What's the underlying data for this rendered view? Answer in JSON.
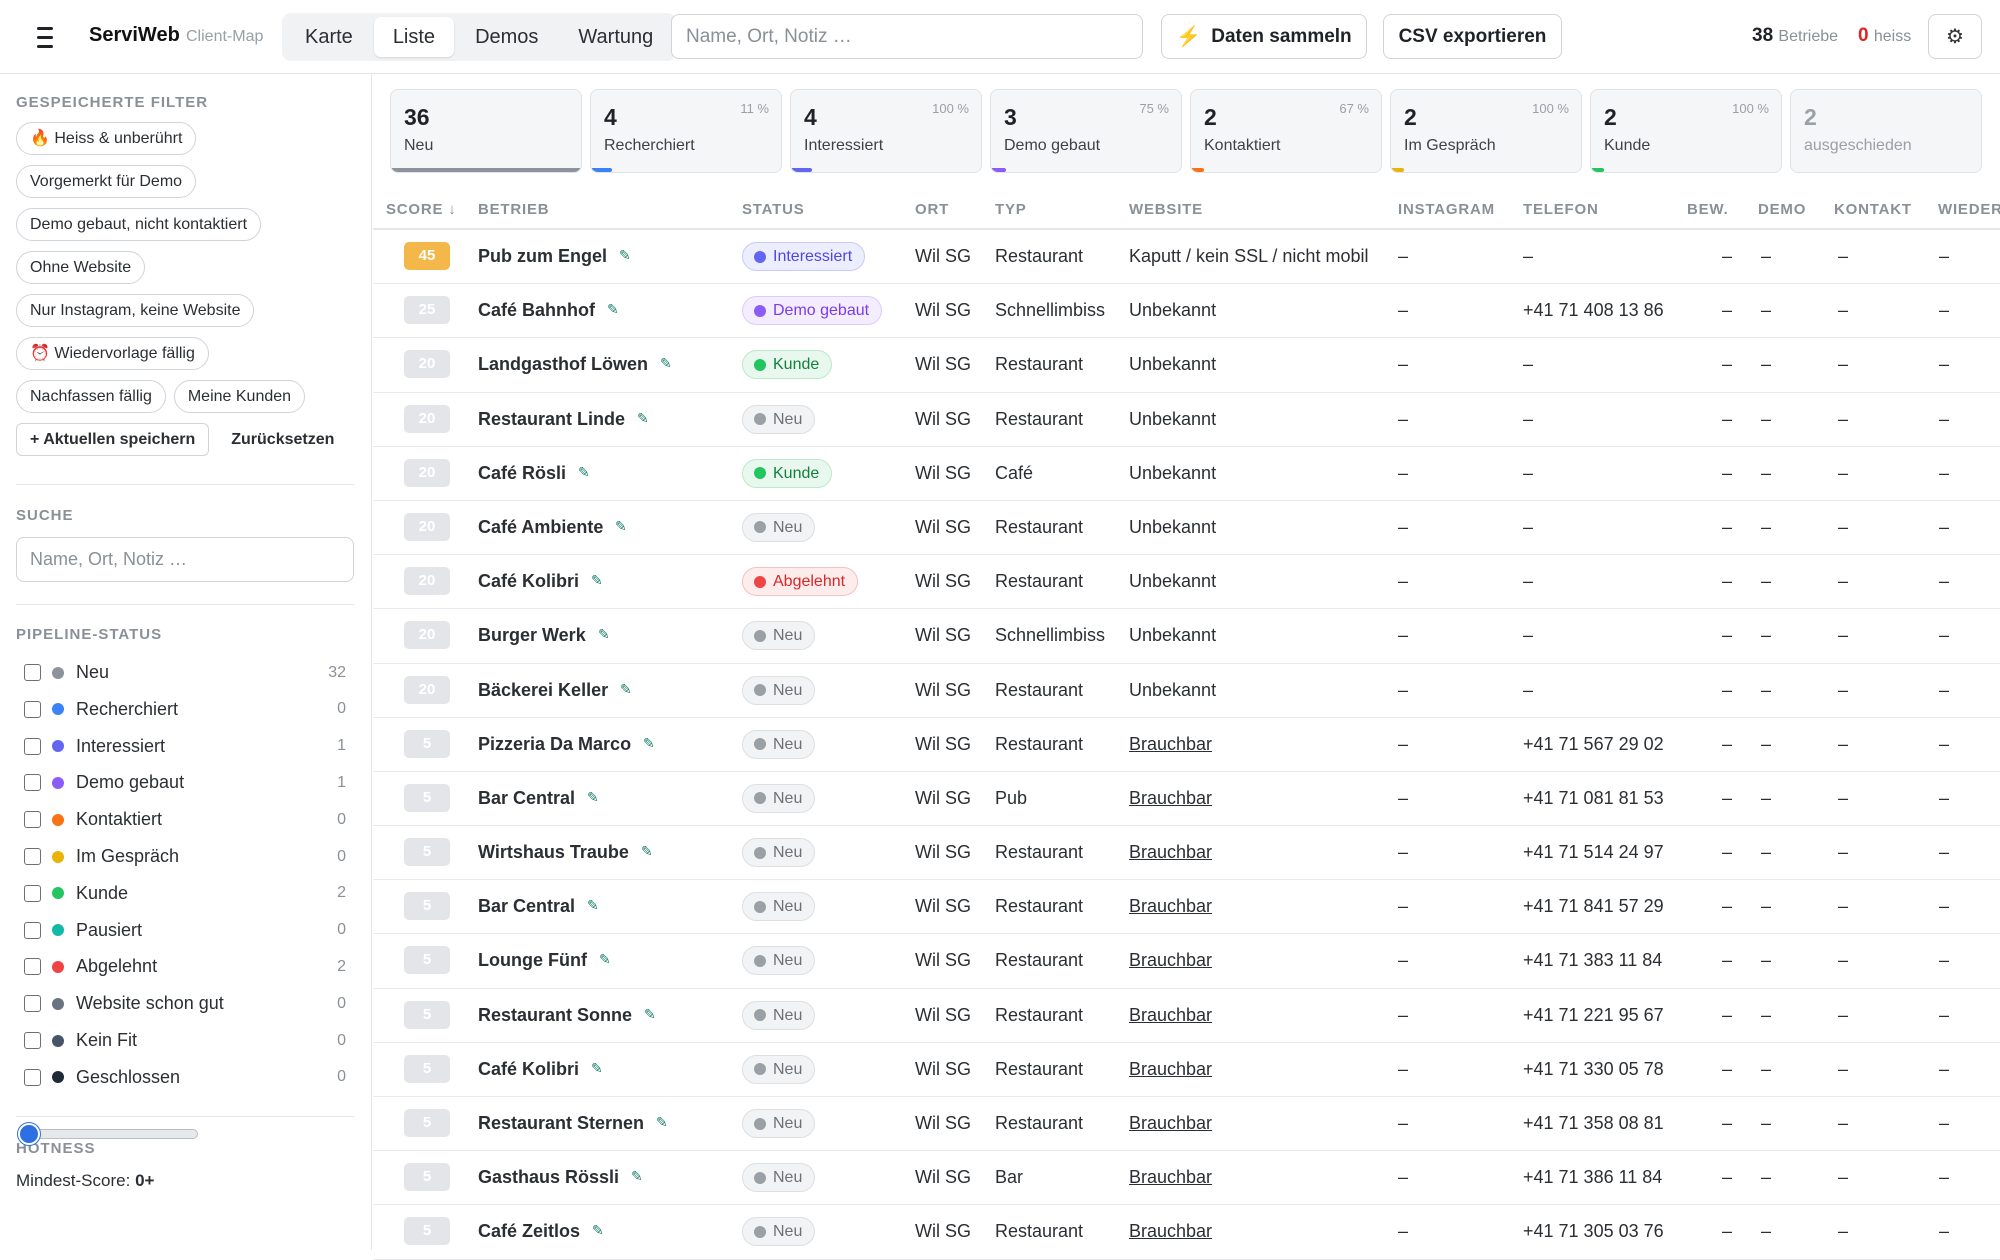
{
  "app": {
    "title": "ServiWeb",
    "subtitle": "Client-Map"
  },
  "nav_tabs": [
    {
      "label": "Karte",
      "active": false
    },
    {
      "label": "Liste",
      "active": true
    },
    {
      "label": "Demos",
      "active": false
    },
    {
      "label": "Wartung",
      "active": false
    }
  ],
  "top_search": {
    "placeholder": "Name, Ort, Notiz …"
  },
  "actions": {
    "collect_label": "Daten sammeln",
    "collect_icon": "bolt-icon",
    "export_label": "CSV exportieren",
    "settings_icon": "gear-icon"
  },
  "stats": {
    "betriebe_count": "38",
    "betriebe_label": "Betriebe",
    "heiss_count": "0",
    "heiss_label": "heiss"
  },
  "sidebar": {
    "saved_filters_title": "GESPEICHERTE FILTER",
    "saved_filters": [
      "🔥 Heiss & unberührt",
      "Vorgemerkt für Demo",
      "Demo gebaut, nicht kontaktiert",
      "Ohne Website",
      "Nur Instagram, keine Website",
      "⏰ Wiedervorlage fällig",
      "Nachfassen fällig",
      "Meine Kunden"
    ],
    "save_current_label": "+ Aktuellen speichern",
    "reset_label": "Zurücksetzen",
    "search_title": "SUCHE",
    "search_placeholder": "Name, Ort, Notiz …",
    "pipeline_title": "PIPELINE-STATUS",
    "pipeline": [
      {
        "label": "Neu",
        "count": "32",
        "color": "#8d939a"
      },
      {
        "label": "Recherchiert",
        "count": "0",
        "color": "#3b82f6"
      },
      {
        "label": "Interessiert",
        "count": "1",
        "color": "#6366f1"
      },
      {
        "label": "Demo gebaut",
        "count": "1",
        "color": "#8b5cf6"
      },
      {
        "label": "Kontaktiert",
        "count": "0",
        "color": "#f97316"
      },
      {
        "label": "Im Gespräch",
        "count": "0",
        "color": "#eab308"
      },
      {
        "label": "Kunde",
        "count": "2",
        "color": "#22c55e"
      },
      {
        "label": "Pausiert",
        "count": "0",
        "color": "#14b8a6"
      },
      {
        "label": "Abgelehnt",
        "count": "2",
        "color": "#ef4444"
      },
      {
        "label": "Website schon gut",
        "count": "0",
        "color": "#6b7280"
      },
      {
        "label": "Kein Fit",
        "count": "0",
        "color": "#475569"
      },
      {
        "label": "Geschlossen",
        "count": "0",
        "color": "#1f2937"
      }
    ],
    "hotness_title": "HOTNESS",
    "min_score_label": "Mindest-Score:",
    "min_score_value": "0+"
  },
  "status_cards": [
    {
      "count": "36",
      "label": "Neu",
      "pct": "",
      "color": "#8d939a",
      "fill": 1.0,
      "dim": false
    },
    {
      "count": "4",
      "label": "Recherchiert",
      "pct": "11 %",
      "color": "#3b82f6",
      "fill": 0.11,
      "dim": false
    },
    {
      "count": "4",
      "label": "Interessiert",
      "pct": "100 %",
      "color": "#6366f1",
      "fill": 0.11,
      "dim": false
    },
    {
      "count": "3",
      "label": "Demo gebaut",
      "pct": "75 %",
      "color": "#8b5cf6",
      "fill": 0.08,
      "dim": false
    },
    {
      "count": "2",
      "label": "Kontaktiert",
      "pct": "67 %",
      "color": "#f97316",
      "fill": 0.06,
      "dim": false
    },
    {
      "count": "2",
      "label": "Im Gespräch",
      "pct": "100 %",
      "color": "#eab308",
      "fill": 0.06,
      "dim": false
    },
    {
      "count": "2",
      "label": "Kunde",
      "pct": "100 %",
      "color": "#22c55e",
      "fill": 0.06,
      "dim": false
    },
    {
      "count": "2",
      "label": "ausgeschieden",
      "pct": "",
      "color": "#cbd0d6",
      "fill": 0,
      "dim": true
    }
  ],
  "table": {
    "columns": [
      "SCORE ↓",
      "BETRIEB",
      "STATUS",
      "ORT",
      "TYP",
      "WEBSITE",
      "INSTAGRAM",
      "TELEFON",
      "BEW.",
      "DEMO",
      "KONTAKT",
      "WIEDER"
    ],
    "rows": [
      {
        "score": "45",
        "hot": true,
        "name": "Pub zum Engel",
        "status": "Interessiert",
        "ort": "Wil SG",
        "typ": "Restaurant",
        "website": "Kaputt / kein SSL / nicht mobil",
        "web_link": false,
        "instagram": "–",
        "telefon": "–",
        "bew": "–",
        "demo": "–",
        "kontakt": "–",
        "wieder": "–"
      },
      {
        "score": "25",
        "hot": false,
        "name": "Café Bahnhof",
        "status": "Demo gebaut",
        "ort": "Wil SG",
        "typ": "Schnellimbiss",
        "website": "Unbekannt",
        "web_link": false,
        "instagram": "–",
        "telefon": "+41 71 408 13 86",
        "bew": "–",
        "demo": "–",
        "kontakt": "–",
        "wieder": "–"
      },
      {
        "score": "20",
        "hot": false,
        "name": "Landgasthof Löwen",
        "status": "Kunde",
        "ort": "Wil SG",
        "typ": "Restaurant",
        "website": "Unbekannt",
        "web_link": false,
        "instagram": "–",
        "telefon": "–",
        "bew": "–",
        "demo": "–",
        "kontakt": "–",
        "wieder": "–"
      },
      {
        "score": "20",
        "hot": false,
        "name": "Restaurant Linde",
        "status": "Neu",
        "ort": "Wil SG",
        "typ": "Restaurant",
        "website": "Unbekannt",
        "web_link": false,
        "instagram": "–",
        "telefon": "–",
        "bew": "–",
        "demo": "–",
        "kontakt": "–",
        "wieder": "–"
      },
      {
        "score": "20",
        "hot": false,
        "name": "Café Rösli",
        "status": "Kunde",
        "ort": "Wil SG",
        "typ": "Café",
        "website": "Unbekannt",
        "web_link": false,
        "instagram": "–",
        "telefon": "–",
        "bew": "–",
        "demo": "–",
        "kontakt": "–",
        "wieder": "–"
      },
      {
        "score": "20",
        "hot": false,
        "name": "Café Ambiente",
        "status": "Neu",
        "ort": "Wil SG",
        "typ": "Restaurant",
        "website": "Unbekannt",
        "web_link": false,
        "instagram": "–",
        "telefon": "–",
        "bew": "–",
        "demo": "–",
        "kontakt": "–",
        "wieder": "–"
      },
      {
        "score": "20",
        "hot": false,
        "name": "Café Kolibri",
        "status": "Abgelehnt",
        "ort": "Wil SG",
        "typ": "Restaurant",
        "website": "Unbekannt",
        "web_link": false,
        "instagram": "–",
        "telefon": "–",
        "bew": "–",
        "demo": "–",
        "kontakt": "–",
        "wieder": "–"
      },
      {
        "score": "20",
        "hot": false,
        "name": "Burger Werk",
        "status": "Neu",
        "ort": "Wil SG",
        "typ": "Schnellimbiss",
        "website": "Unbekannt",
        "web_link": false,
        "instagram": "–",
        "telefon": "–",
        "bew": "–",
        "demo": "–",
        "kontakt": "–",
        "wieder": "–"
      },
      {
        "score": "20",
        "hot": false,
        "name": "Bäckerei Keller",
        "status": "Neu",
        "ort": "Wil SG",
        "typ": "Restaurant",
        "website": "Unbekannt",
        "web_link": false,
        "instagram": "–",
        "telefon": "–",
        "bew": "–",
        "demo": "–",
        "kontakt": "–",
        "wieder": "–"
      },
      {
        "score": "5",
        "hot": false,
        "name": "Pizzeria Da Marco",
        "status": "Neu",
        "ort": "Wil SG",
        "typ": "Restaurant",
        "website": "Brauchbar",
        "web_link": true,
        "instagram": "–",
        "telefon": "+41 71 567 29 02",
        "bew": "–",
        "demo": "–",
        "kontakt": "–",
        "wieder": "–"
      },
      {
        "score": "5",
        "hot": false,
        "name": "Bar Central",
        "status": "Neu",
        "ort": "Wil SG",
        "typ": "Pub",
        "website": "Brauchbar",
        "web_link": true,
        "instagram": "–",
        "telefon": "+41 71 081 81 53",
        "bew": "–",
        "demo": "–",
        "kontakt": "–",
        "wieder": "–"
      },
      {
        "score": "5",
        "hot": false,
        "name": "Wirtshaus Traube",
        "status": "Neu",
        "ort": "Wil SG",
        "typ": "Restaurant",
        "website": "Brauchbar",
        "web_link": true,
        "instagram": "–",
        "telefon": "+41 71 514 24 97",
        "bew": "–",
        "demo": "–",
        "kontakt": "–",
        "wieder": "–"
      },
      {
        "score": "5",
        "hot": false,
        "name": "Bar Central",
        "status": "Neu",
        "ort": "Wil SG",
        "typ": "Restaurant",
        "website": "Brauchbar",
        "web_link": true,
        "instagram": "–",
        "telefon": "+41 71 841 57 29",
        "bew": "–",
        "demo": "–",
        "kontakt": "–",
        "wieder": "–"
      },
      {
        "score": "5",
        "hot": false,
        "name": "Lounge Fünf",
        "status": "Neu",
        "ort": "Wil SG",
        "typ": "Restaurant",
        "website": "Brauchbar",
        "web_link": true,
        "instagram": "–",
        "telefon": "+41 71 383 11 84",
        "bew": "–",
        "demo": "–",
        "kontakt": "–",
        "wieder": "–"
      },
      {
        "score": "5",
        "hot": false,
        "name": "Restaurant Sonne",
        "status": "Neu",
        "ort": "Wil SG",
        "typ": "Restaurant",
        "website": "Brauchbar",
        "web_link": true,
        "instagram": "–",
        "telefon": "+41 71 221 95 67",
        "bew": "–",
        "demo": "–",
        "kontakt": "–",
        "wieder": "–"
      },
      {
        "score": "5",
        "hot": false,
        "name": "Café Kolibri",
        "status": "Neu",
        "ort": "Wil SG",
        "typ": "Restaurant",
        "website": "Brauchbar",
        "web_link": true,
        "instagram": "–",
        "telefon": "+41 71 330 05 78",
        "bew": "–",
        "demo": "–",
        "kontakt": "–",
        "wieder": "–"
      },
      {
        "score": "5",
        "hot": false,
        "name": "Restaurant Sternen",
        "status": "Neu",
        "ort": "Wil SG",
        "typ": "Restaurant",
        "website": "Brauchbar",
        "web_link": true,
        "instagram": "–",
        "telefon": "+41 71 358 08 81",
        "bew": "–",
        "demo": "–",
        "kontakt": "–",
        "wieder": "–"
      },
      {
        "score": "5",
        "hot": false,
        "name": "Gasthaus Rössli",
        "status": "Neu",
        "ort": "Wil SG",
        "typ": "Bar",
        "website": "Brauchbar",
        "web_link": true,
        "instagram": "–",
        "telefon": "+41 71 386 11 84",
        "bew": "–",
        "demo": "–",
        "kontakt": "–",
        "wieder": "–"
      },
      {
        "score": "5",
        "hot": false,
        "name": "Café Zeitlos",
        "status": "Neu",
        "ort": "Wil SG",
        "typ": "Restaurant",
        "website": "Brauchbar",
        "web_link": true,
        "instagram": "–",
        "telefon": "+41 71 305 03 76",
        "bew": "–",
        "demo": "–",
        "kontakt": "–",
        "wieder": "–"
      }
    ]
  },
  "status_styles": {
    "Interessiert": {
      "bg": "#eceefe",
      "border": "#c7cbfb",
      "text": "#4f46e5",
      "dot": "#6366f1"
    },
    "Demo gebaut": {
      "bg": "#f3edfe",
      "border": "#dccbfb",
      "text": "#7c3aed",
      "dot": "#8b5cf6"
    },
    "Kunde": {
      "bg": "#e8f8ee",
      "border": "#b9ebcb",
      "text": "#15803d",
      "dot": "#22c55e"
    },
    "Neu": {
      "bg": "#f2f3f5",
      "border": "#dcdfe3",
      "text": "#6b7177",
      "dot": "#9aa0a6"
    },
    "Abgelehnt": {
      "bg": "#fdecec",
      "border": "#f6c2c2",
      "text": "#dc2626",
      "dot": "#ef4444"
    }
  }
}
